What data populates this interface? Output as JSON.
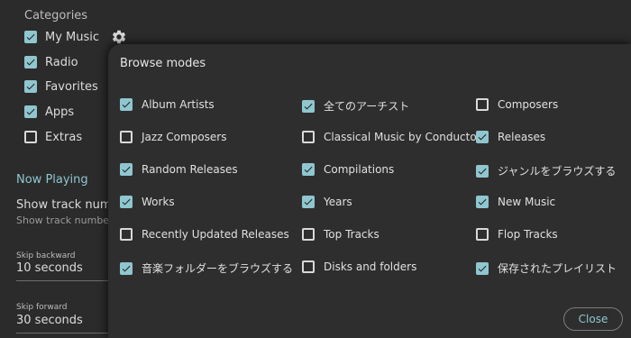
{
  "settings": {
    "categories_title": "Categories",
    "categories": [
      {
        "label": "My Music",
        "checked": true
      },
      {
        "label": "Radio",
        "checked": true
      },
      {
        "label": "Favorites",
        "checked": true
      },
      {
        "label": "Apps",
        "checked": true
      },
      {
        "label": "Extras",
        "checked": false
      }
    ],
    "gear_icon": "gear-icon",
    "now_playing": "Now Playing",
    "show_track_number": "Show track number",
    "show_track_number_sub": "Show track number nex",
    "skip_backward_label": "Skip backward",
    "skip_backward_value": "10 seconds",
    "skip_forward_label": "Skip forward",
    "skip_forward_value": "30 seconds"
  },
  "dialog": {
    "title": "Browse modes",
    "close_label": "Close",
    "columns": [
      [
        {
          "label": "Album Artists",
          "checked": true
        },
        {
          "label": "Jazz Composers",
          "checked": false
        },
        {
          "label": "Random Releases",
          "checked": true
        },
        {
          "label": "Works",
          "checked": true
        },
        {
          "label": "Recently Updated Releases",
          "checked": false
        },
        {
          "label": "音楽フォルダーをブラウズする",
          "checked": true
        }
      ],
      [
        {
          "label": "全てのアーチスト",
          "checked": true
        },
        {
          "label": "Classical Music by Conductor",
          "checked": false
        },
        {
          "label": "Compilations",
          "checked": true
        },
        {
          "label": "Years",
          "checked": true
        },
        {
          "label": "Top Tracks",
          "checked": false
        },
        {
          "label": "Disks and folders",
          "checked": false
        }
      ],
      [
        {
          "label": "Composers",
          "checked": false
        },
        {
          "label": "Releases",
          "checked": true
        },
        {
          "label": "ジャンルをブラウズする",
          "checked": true
        },
        {
          "label": "New Music",
          "checked": true
        },
        {
          "label": "Flop Tracks",
          "checked": false
        },
        {
          "label": "保存されたプレイリスト",
          "checked": true
        }
      ]
    ]
  },
  "colors": {
    "accent": "#8fc6cf",
    "background": "#2b2b2b",
    "dialog": "#2e2e2e"
  }
}
